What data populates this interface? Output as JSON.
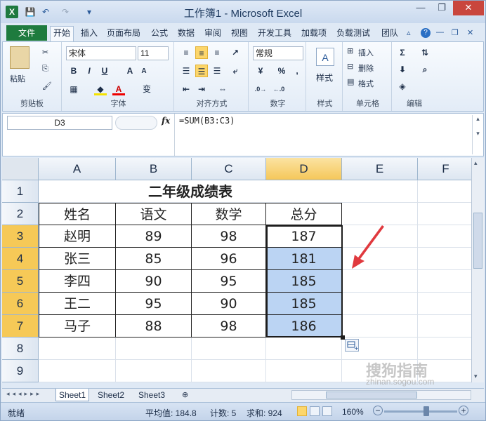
{
  "window": {
    "title": "工作簿1 - Microsoft Excel",
    "app_icon": "X"
  },
  "quick_access": {
    "save_icon": "💾",
    "undo_icon": "↶",
    "redo_icon": "↷"
  },
  "ribbon_tabs": {
    "file": "文件",
    "tabs": [
      "开始",
      "插入",
      "页面布局",
      "公式",
      "数据",
      "审阅",
      "视图",
      "开发工具",
      "加载项",
      "负载测试",
      "团队"
    ]
  },
  "ribbon": {
    "clipboard": {
      "label": "剪贴板",
      "paste": "粘贴"
    },
    "font": {
      "label": "字体",
      "name": "宋体",
      "size": "11",
      "bold": "B",
      "italic": "I",
      "underline": "U",
      "grow": "A",
      "shrink": "A",
      "wen": "变",
      "font_color": "A"
    },
    "alignment": {
      "label": "对齐方式"
    },
    "number": {
      "label": "数字",
      "format": "常规",
      "percent": "%",
      "comma": ","
    },
    "styles": {
      "label": "样式"
    },
    "cells": {
      "label": "单元格",
      "insert": "插入",
      "delete": "删除",
      "format": "格式"
    },
    "editing": {
      "label": "编辑",
      "sum": "Σ"
    }
  },
  "formula_bar": {
    "name_box": "D3",
    "fx": "fx",
    "formula": "=SUM(B3:C3)"
  },
  "sheet": {
    "columns": [
      "A",
      "B",
      "C",
      "D",
      "E",
      "F"
    ],
    "rows": [
      "1",
      "2",
      "3",
      "4",
      "5",
      "6",
      "7",
      "8",
      "9"
    ],
    "title": "二年级成绩表",
    "headers": [
      "姓名",
      "语文",
      "数学",
      "总分"
    ],
    "data": [
      [
        "赵明",
        "89",
        "98",
        "187"
      ],
      [
        "张三",
        "85",
        "96",
        "181"
      ],
      [
        "李四",
        "90",
        "95",
        "185"
      ],
      [
        "王二",
        "95",
        "90",
        "185"
      ],
      [
        "马子",
        "88",
        "98",
        "186"
      ]
    ]
  },
  "sheet_tabs": [
    "Sheet1",
    "Sheet2",
    "Sheet3"
  ],
  "status": {
    "mode": "就绪",
    "average": "平均值: 184.8",
    "count": "计数: 5",
    "sum": "求和: 924",
    "zoom": "160%"
  },
  "watermark": {
    "brand": "搜狗指南",
    "url": "zhinan.sogou.com"
  },
  "colors": {
    "accent": "#1e7b3e",
    "selection": "#bbd4f3",
    "arrow": "#e0393e"
  }
}
